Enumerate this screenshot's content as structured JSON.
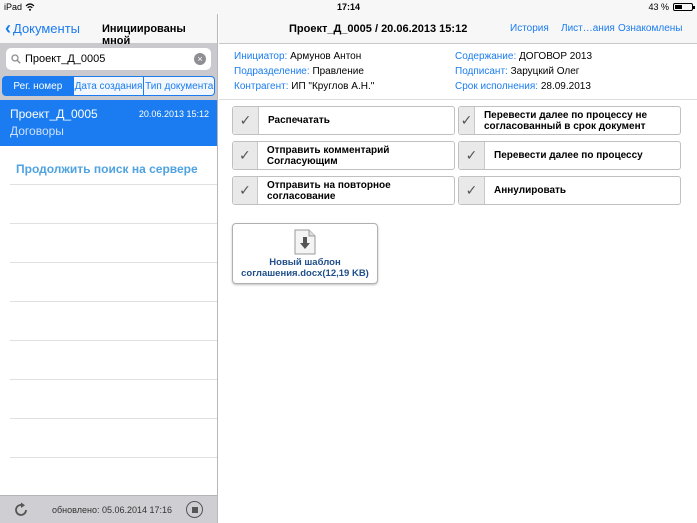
{
  "status": {
    "device": "iPad",
    "time": "17:14",
    "battery": "43 %",
    "battery_level": 0.43
  },
  "left": {
    "back_label": "Документы",
    "title": "Инициированы мной",
    "search": {
      "value": "Проект_Д_0005",
      "placeholder": ""
    },
    "segments": [
      "Рег. номер",
      "Дата создания",
      "Тип документа"
    ],
    "selected_segment": 0,
    "document": {
      "name": "Проект_Д_0005",
      "date": "20.06.2013 15:12",
      "type": "Договоры"
    },
    "server_search": "Продолжить поиск на сервере",
    "updated": "обновлено: 05.06.2014 17:16"
  },
  "right": {
    "title": "Проект_Д_0005 / 20.06.2013 15:12",
    "nav": {
      "history": "История",
      "sheets": "Лист…ания",
      "acquainted": "Ознакомлены"
    },
    "meta": {
      "initiator_key": "Инициатор:",
      "initiator": "Армунов Антон",
      "content_key": "Содержание:",
      "content": "ДОГОВОР 2013",
      "department_key": "Подразделение:",
      "department": "Правление",
      "signer_key": "Подписант:",
      "signer": "Заруцкий Олег",
      "contractor_key": "Контрагент:",
      "contractor": "ИП \"Круглов А.Н.\"",
      "deadline_key": "Срок исполнения:",
      "deadline": "28.09.2013"
    },
    "actions": [
      "Распечатать",
      "Перевести далее по процессу не согласованный в срок документ",
      "Отправить комментарий Согласующим",
      "Перевести далее по процессу",
      "Отправить на повторное согласование",
      "Аннулировать"
    ],
    "file": {
      "name": "Новый шаблон соглашения.docx(12,19 KB)"
    }
  },
  "colors": {
    "accent": "#1a7cf0",
    "nav_bg": "#f7f7f8",
    "search_bg": "#c9c9ce"
  }
}
